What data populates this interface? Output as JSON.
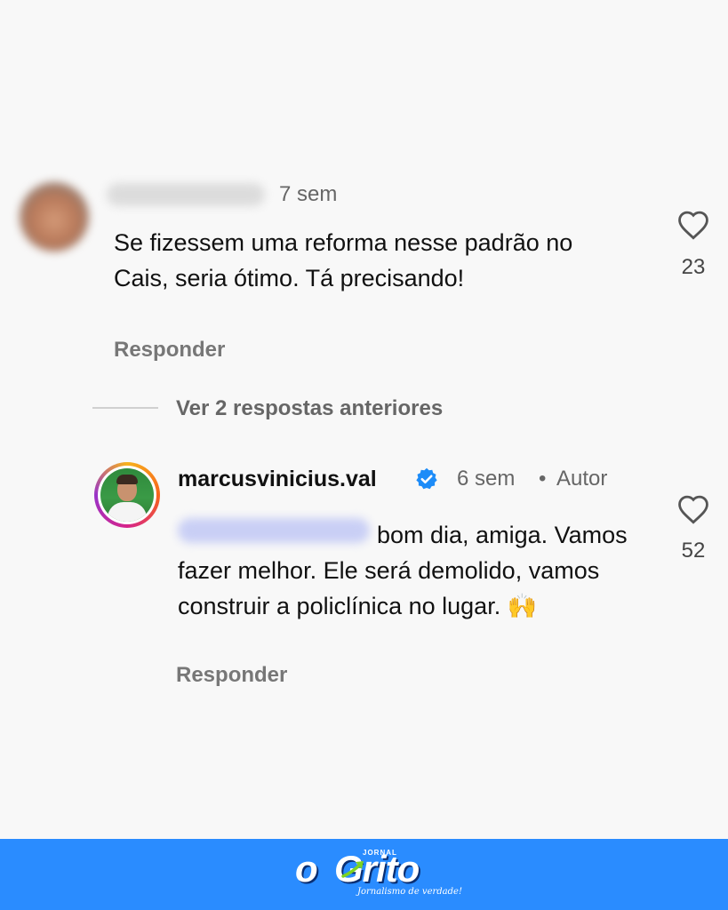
{
  "comment1": {
    "time": "7 sem",
    "text": "Se fizessem uma reforma nesse padrão no Cais, seria ótimo. Tá precisando!",
    "reply_label": "Responder",
    "likes": "23"
  },
  "thread": {
    "view_replies": "Ver 2 respostas anteriores"
  },
  "comment2": {
    "username": "marcusvinicius.val",
    "time": "6 sem",
    "separator": "•",
    "author_label": "Autor",
    "text": "bom dia, amiga. Vamos fazer melhor. Ele será demolido, vamos construir a policlínica no lugar. 🙌",
    "reply_label": "Responder",
    "likes": "52"
  },
  "footer": {
    "logo_o": "o",
    "logo_name": "Grito",
    "logo_small": "JORNAL",
    "slogan": "Jornalismo de verdade!",
    "background": "#2a8cff"
  },
  "icons": [
    "heart-icon",
    "verified-badge-icon",
    "logo-arrow-icon"
  ]
}
